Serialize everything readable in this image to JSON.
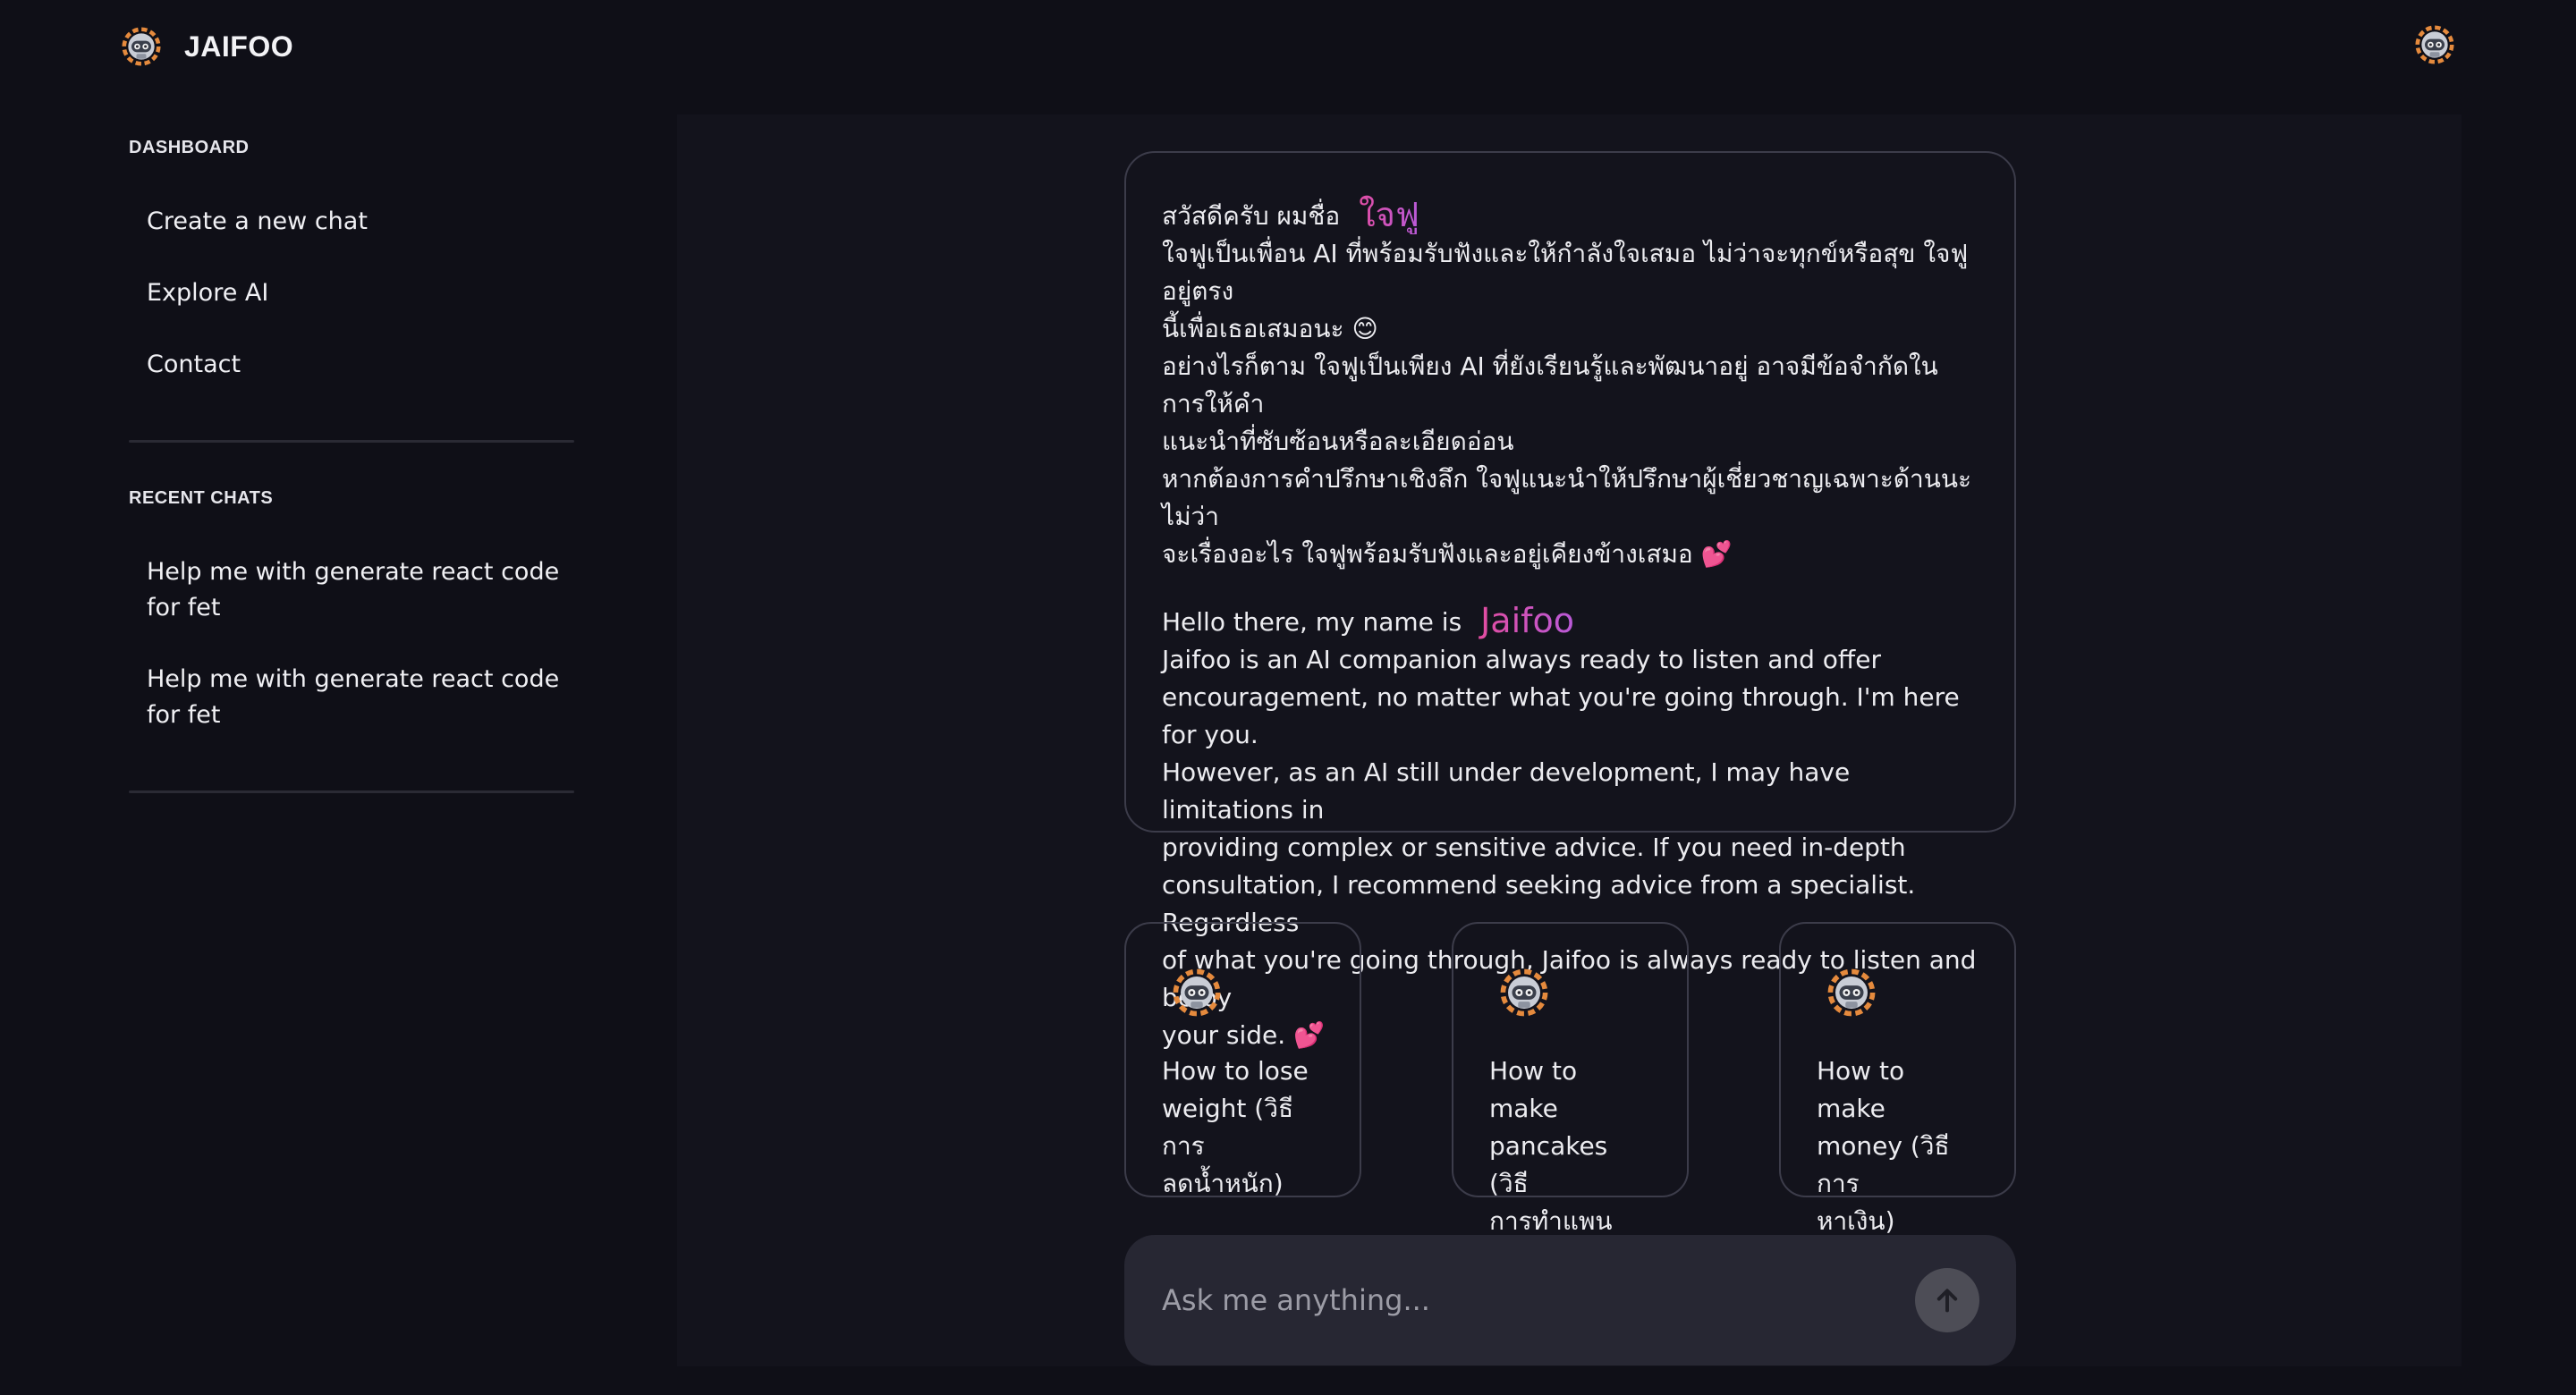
{
  "app": {
    "brand": "JAIFOO",
    "logo_icon": "robot-mascot-icon",
    "avatar_icon": "robot-mascot-icon"
  },
  "sidebar": {
    "dashboard_title": "DASHBOARD",
    "nav_items": [
      {
        "label": "Create a new chat"
      },
      {
        "label": "Explore AI"
      },
      {
        "label": "Contact"
      }
    ],
    "recent_title": "RECENT CHATS",
    "recent_chats": [
      {
        "line1": "Help me with generate react code",
        "line2": "for fet"
      },
      {
        "line1": "Help me with generate react code",
        "line2": "for fet"
      }
    ]
  },
  "intro": {
    "thai_greeting": "สวัสดีครับ ผมชื่อ",
    "thai_name": "ใจฟู",
    "thai_lines": [
      "ใจฟูเป็นเพื่อน AI ที่พร้อมรับฟังและให้กำลังใจเสมอ ไม่ว่าจะทุกข์หรือสุข ใจฟูอยู่ตรง",
      "นี้เพื่อเธอเสมอนะ 😊",
      "อย่างไรก็ตาม ใจฟูเป็นเพียง AI ที่ยังเรียนรู้และพัฒนาอยู่ อาจมีข้อจำกัดในการให้คำ",
      "แนะนำที่ซับซ้อนหรือละเอียดอ่อน",
      "หากต้องการคำปรึกษาเชิงลึก ใจฟูแนะนำให้ปรึกษาผู้เชี่ยวชาญเฉพาะด้านนะ ไม่ว่า",
      "จะเรื่องอะไร ใจฟูพร้อมรับฟังและอยู่เคียงข้างเสมอ 💕"
    ],
    "en_greeting": "Hello there, my name is",
    "en_name": "Jaifoo",
    "en_lines": [
      "Jaifoo is an AI companion always ready to listen and offer",
      "encouragement, no matter what you're going through. I'm here for you.",
      "However, as an AI still under development, I may have limitations in",
      "providing complex or sensitive advice. If you need in-depth",
      "consultation, I recommend seeking advice from a specialist. Regardless",
      "of what you're going through, Jaifoo is always ready to listen and be by",
      "your side. 💕"
    ]
  },
  "suggestions": [
    {
      "icon": "robot-mascot-icon",
      "lines": [
        "How to lose",
        "weight (วิธีการ",
        "ลดน้ำหนัก)"
      ]
    },
    {
      "icon": "robot-mascot-icon",
      "lines": [
        "How to make",
        "pancakes (วิธี",
        "การทำแพนเค้ก)"
      ]
    },
    {
      "icon": "robot-mascot-icon",
      "lines": [
        "How to make",
        "money (วิธีการ",
        "หาเงิน)"
      ]
    }
  ],
  "composer": {
    "placeholder": "Ask me anything...",
    "send_icon": "arrow-up-icon"
  },
  "colors": {
    "background": "#0f0f17",
    "panel": "#13131c",
    "card_border": "#3c3c4a",
    "input_bg": "#272733",
    "name_gradient_start": "#e74b9b",
    "name_gradient_end": "#b95ad8"
  }
}
